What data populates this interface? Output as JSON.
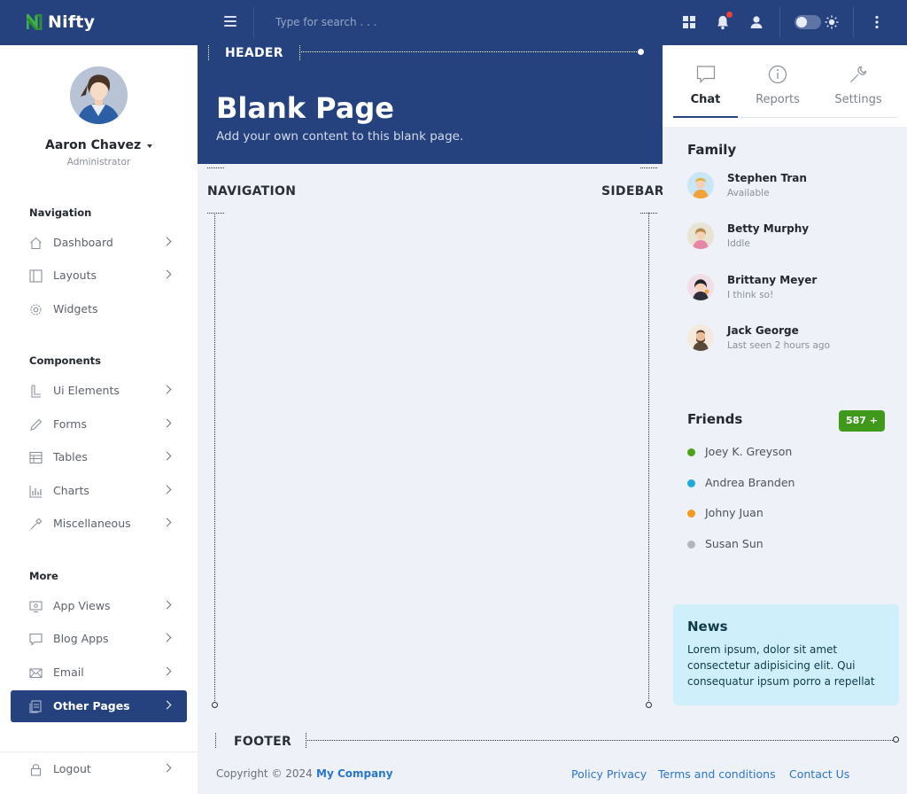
{
  "app": {
    "brand": "Nifty"
  },
  "topbar": {
    "search_placeholder": "Type for search . . .",
    "icons": [
      "menu-icon",
      "grid-icon",
      "bell-icon",
      "user-icon",
      "theme-toggle",
      "sun-icon",
      "more-vertical-icon"
    ]
  },
  "user": {
    "name": "Aaron Chavez",
    "role": "Administrator"
  },
  "nav": {
    "sections": [
      {
        "title": "Navigation",
        "items": [
          {
            "label": "Dashboard",
            "icon": "home-icon",
            "chevron": true
          },
          {
            "label": "Layouts",
            "icon": "layout-icon",
            "chevron": true
          },
          {
            "label": "Widgets",
            "icon": "widget-gear-icon",
            "chevron": false
          }
        ]
      },
      {
        "title": "Components",
        "items": [
          {
            "label": "Ui Elements",
            "icon": "ui-elements-icon",
            "chevron": true
          },
          {
            "label": "Forms",
            "icon": "pencil-icon",
            "chevron": true
          },
          {
            "label": "Tables",
            "icon": "table-icon",
            "chevron": true
          },
          {
            "label": "Charts",
            "icon": "chart-icon",
            "chevron": true
          },
          {
            "label": "Miscellaneous",
            "icon": "misc-icon",
            "chevron": true
          }
        ]
      },
      {
        "title": "More",
        "items": [
          {
            "label": "App Views",
            "icon": "monitor-icon",
            "chevron": true
          },
          {
            "label": "Blog Apps",
            "icon": "chat-bubble-icon",
            "chevron": true
          },
          {
            "label": "Email",
            "icon": "mail-icon",
            "chevron": true
          },
          {
            "label": "Other Pages",
            "icon": "pages-icon",
            "chevron": true,
            "active": true
          }
        ]
      }
    ],
    "logout": "Logout"
  },
  "page": {
    "title": "Blank Page",
    "subtitle": "Add your own content to this blank page.",
    "labels": {
      "header": "HEADER",
      "navigation": "NAVIGATION",
      "sidebar": "SIDEBAR",
      "footer": "FOOTER"
    }
  },
  "right_sidebar": {
    "tabs": [
      {
        "label": "Chat",
        "icon": "chat-icon",
        "active": true
      },
      {
        "label": "Reports",
        "icon": "info-icon",
        "active": false
      },
      {
        "label": "Settings",
        "icon": "wrench-icon",
        "active": false
      }
    ],
    "family_title": "Family",
    "family": [
      {
        "name": "Stephen Tran",
        "status": "Available"
      },
      {
        "name": "Betty Murphy",
        "status": "Iddle"
      },
      {
        "name": "Brittany Meyer",
        "status": "I think so!"
      },
      {
        "name": "Jack George",
        "status": "Last seen 2 hours ago"
      }
    ],
    "friends_title": "Friends",
    "friends_badge": "587 +",
    "friends": [
      {
        "name": "Joey K. Greyson",
        "color": "#4ea21a"
      },
      {
        "name": "Andrea Branden",
        "color": "#1eaadd"
      },
      {
        "name": "Johny Juan",
        "color": "#f09a1e"
      },
      {
        "name": "Susan Sun",
        "color": "#b2b6bc"
      }
    ],
    "news": {
      "title": "News",
      "body": "Lorem ipsum, dolor sit amet consectetur adipisicing elit. Qui consequatur ipsum porro a repellat"
    }
  },
  "footer": {
    "copyright": "Copyright © 2024",
    "company": "My Company",
    "links": [
      "Policy Privacy",
      "Terms and conditions",
      "Contact Us"
    ]
  },
  "colors": {
    "primary": "#25427e",
    "accent_green": "#3f9a1b",
    "link": "#2a76c9",
    "news_bg": "#cfeffa"
  }
}
